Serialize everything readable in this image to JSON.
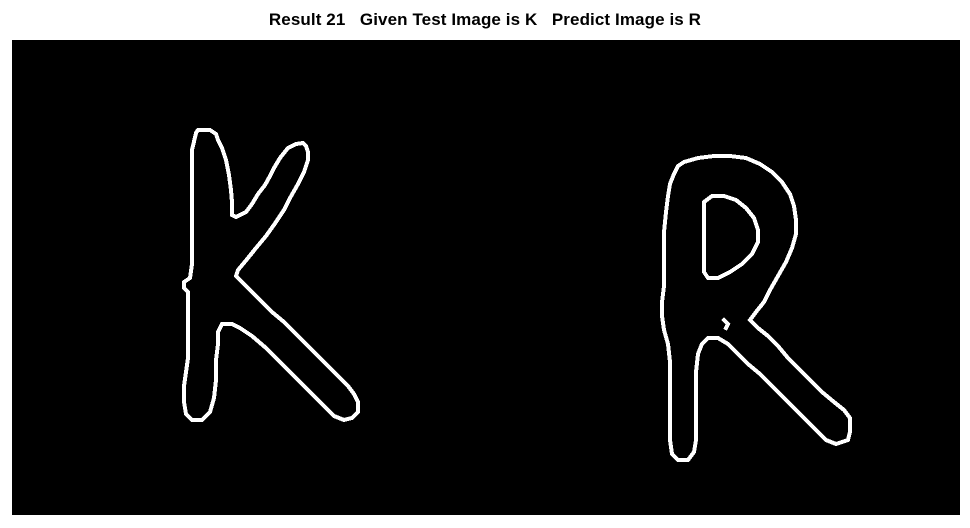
{
  "figure": {
    "title": "Result 21   Given Test Image is K   Predict Image is R",
    "colors": {
      "background": "#ffffff",
      "image_background": "#000000",
      "stroke": "#ffffff"
    },
    "panels": [
      {
        "role": "given-test-image",
        "letter": "K"
      },
      {
        "role": "predicted-image",
        "letter": "R"
      }
    ]
  }
}
